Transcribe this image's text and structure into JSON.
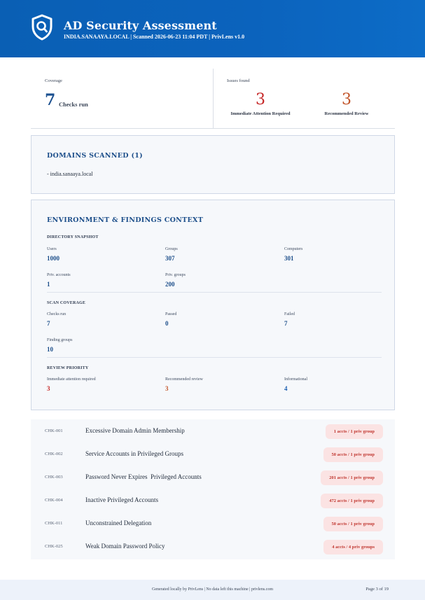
{
  "header": {
    "title": "AD Security Assessment",
    "subtitle": "INDIA.SANAAYA.LOCAL | Scanned 2026-06-23 11:04 PDT | PrivLens v1.0",
    "logo_icon": "shield-search-icon"
  },
  "summary": {
    "coverage_label": "Coverage",
    "coverage_value": "7",
    "coverage_text": "Checks run",
    "issues_label": "Issues found",
    "immediate_value": "3",
    "immediate_text": "Immediate Attention Required",
    "recommended_value": "3",
    "recommended_text": "Recommended Review",
    "immediate_color": "#c62828",
    "recommended_color": "#c2552a"
  },
  "domains": {
    "title": "DOMAINS SCANNED (1)",
    "items": [
      "- india.sanaaya.local"
    ]
  },
  "environment": {
    "title": "ENVIRONMENT & FINDINGS CONTEXT",
    "directory": {
      "label": "DIRECTORY SNAPSHOT",
      "users_label": "Users",
      "users": "1000",
      "groups_label": "Groups",
      "groups": "307",
      "computers_label": "Computers",
      "computers": "301",
      "priv_accounts_label": "Priv. accounts",
      "priv_accounts": "1",
      "priv_groups_label": "Priv. groups",
      "priv_groups": "200"
    },
    "scan": {
      "label": "SCAN COVERAGE",
      "checks_run_label": "Checks run",
      "checks_run": "7",
      "passed_label": "Passed",
      "passed": "0",
      "failed_label": "Failed",
      "failed": "7",
      "finding_groups_label": "Finding groups",
      "finding_groups": "10"
    },
    "priority": {
      "label": "REVIEW PRIORITY",
      "immediate_label": "Immediate attention required",
      "immediate": "3",
      "recommended_label": "Recommended review",
      "recommended": "3",
      "informational_label": "Informational",
      "informational": "4"
    }
  },
  "checks": [
    {
      "id": "CHK-001",
      "name": "Excessive Domain Admin Membership",
      "badge": "1 accts / 1 priv group"
    },
    {
      "id": "CHK-002",
      "name": "Service Accounts in Privileged Groups",
      "badge": "50 accts / 1 priv group"
    },
    {
      "id": "CHK-003",
      "name": "Password Never Expires  Privileged Accounts",
      "badge": "201 accts / 1 priv group"
    },
    {
      "id": "CHK-004",
      "name": "Inactive Privileged Accounts",
      "badge": "472 accts / 1 priv group"
    },
    {
      "id": "CHK-011",
      "name": "Unconstrained Delegation",
      "badge": "50 accts / 1 priv group"
    },
    {
      "id": "CHK-025",
      "name": "Weak Domain Password Policy",
      "badge": "4 accts / 4 priv groups"
    }
  ],
  "footer": {
    "text": "Generated locally by PrivLens | No data left this machine | privlens.com",
    "page": "Page 3 of 19"
  }
}
